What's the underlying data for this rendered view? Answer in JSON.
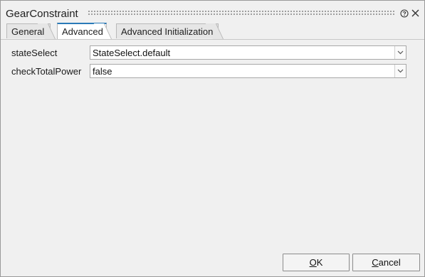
{
  "window": {
    "title": "GearConstraint",
    "help_icon": "help-circle-icon",
    "close_icon": "close-icon"
  },
  "tabs": [
    {
      "label": "General",
      "active": false
    },
    {
      "label": "Advanced",
      "active": true
    },
    {
      "label": "Advanced Initialization",
      "active": false
    }
  ],
  "fields": [
    {
      "label": "stateSelect",
      "value": "StateSelect.default"
    },
    {
      "label": "checkTotalPower",
      "value": "false"
    }
  ],
  "buttons": {
    "ok": {
      "mnemonic": "O",
      "rest": "K"
    },
    "cancel": {
      "mnemonic": "C",
      "rest": "ancel"
    }
  },
  "colors": {
    "active_tab_accent": "#2a7ab8",
    "background": "#f0f0f0"
  }
}
